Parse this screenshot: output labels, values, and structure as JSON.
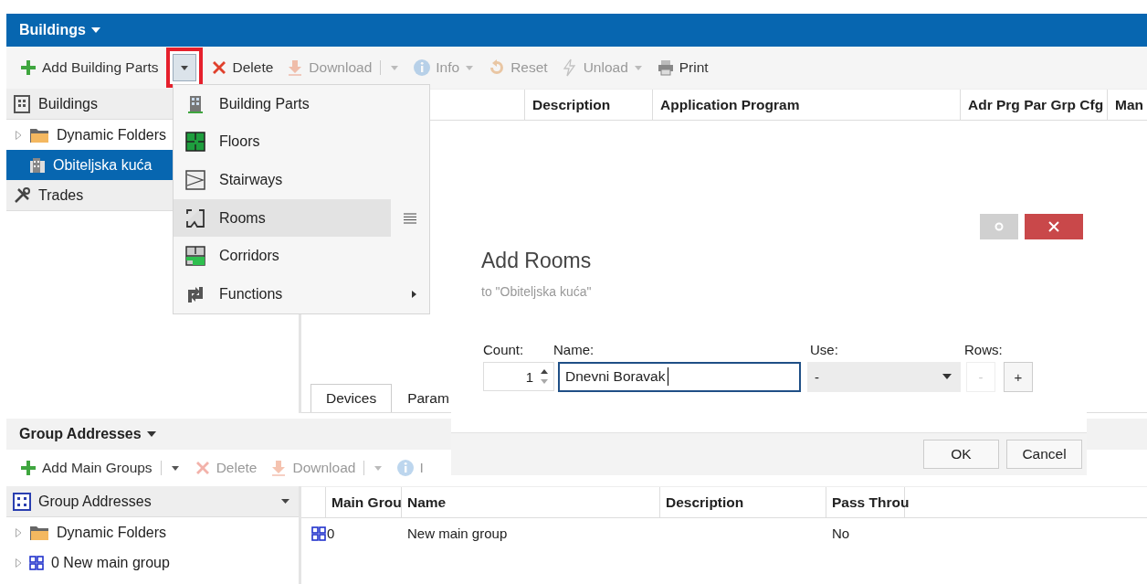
{
  "buildings_panel": {
    "title": "Buildings",
    "toolbar": [
      {
        "kind": "add",
        "label": "Add Building Parts",
        "disabled": false,
        "caret": false,
        "separator": false
      },
      {
        "kind": "dropdown",
        "highlighted": true
      },
      {
        "kind": "delete",
        "label": "Delete",
        "disabled": false,
        "caret": false,
        "separator": false
      },
      {
        "kind": "download",
        "label": "Download",
        "disabled": true,
        "caret": true,
        "separator": true
      },
      {
        "kind": "info",
        "label": "Info",
        "disabled": true,
        "caret": true,
        "separator": false
      },
      {
        "kind": "reset",
        "label": "Reset",
        "disabled": true,
        "caret": false,
        "separator": false
      },
      {
        "kind": "unload",
        "label": "Unload",
        "disabled": true,
        "caret": true,
        "separator": false
      },
      {
        "kind": "print",
        "label": "Print",
        "disabled": false,
        "caret": false,
        "separator": false
      }
    ],
    "tree_header": "Buildings",
    "tree": [
      {
        "kind": "folder",
        "label": "Dynamic Folders",
        "selected": false,
        "expander": true
      },
      {
        "kind": "building",
        "label": "Obiteljska kuća",
        "selected": true,
        "expander": false
      }
    ],
    "trades": "Trades",
    "columns": [
      "",
      "Description",
      "Application Program",
      "Adr Prg Par Grp Cfg",
      "Man"
    ],
    "tabs": [
      {
        "label": "Devices",
        "selected": true
      },
      {
        "label": "Param",
        "selected": false
      }
    ]
  },
  "menu": [
    {
      "kind": "building",
      "label": "Building Parts",
      "selected": false,
      "submenu": false
    },
    {
      "kind": "floor",
      "label": "Floors",
      "selected": false,
      "submenu": false
    },
    {
      "kind": "stairs",
      "label": "Stairways",
      "selected": false,
      "submenu": false
    },
    {
      "kind": "room",
      "label": "Rooms",
      "selected": true,
      "submenu": false
    },
    {
      "kind": "corridor",
      "label": "Corridors",
      "selected": false,
      "submenu": false
    },
    {
      "kind": "function",
      "label": "Functions",
      "selected": false,
      "submenu": true
    }
  ],
  "dialog": {
    "title": "Add Rooms",
    "subtitle": "to \"Obiteljska kuća\"",
    "count_label": "Count:",
    "count": "1",
    "name_label": "Name:",
    "name": "Dnevni Boravak",
    "use_label": "Use:",
    "use": "-",
    "rows_label": "Rows:",
    "minus": "-",
    "minus_disabled": true,
    "plus": "+",
    "buttons": [
      "OK",
      "Cancel"
    ]
  },
  "group_panel": {
    "title": "Group Addresses",
    "toolbar": [
      {
        "kind": "add",
        "label": "Add Main Groups",
        "disabled": false,
        "caret": true,
        "separator": true
      },
      {
        "kind": "delete",
        "label": "Delete",
        "disabled": true,
        "caret": false,
        "separator": false
      },
      {
        "kind": "download",
        "label": "Download",
        "disabled": true,
        "caret": true,
        "separator": true
      },
      {
        "kind": "info",
        "label": "I",
        "disabled": true,
        "caret": false,
        "separator": false
      }
    ],
    "tree_header": "Group Addresses",
    "tree": [
      {
        "kind": "folder",
        "label": "Dynamic Folders",
        "selected": false,
        "expander": true
      },
      {
        "kind": "group",
        "label": "0 New main group",
        "selected": false,
        "expander": true
      }
    ],
    "columns": [
      "Main Grou",
      "Name",
      "Description",
      "Pass Throu"
    ],
    "rows": [
      {
        "main": "0",
        "name": "New main group",
        "pass": "No"
      }
    ]
  }
}
